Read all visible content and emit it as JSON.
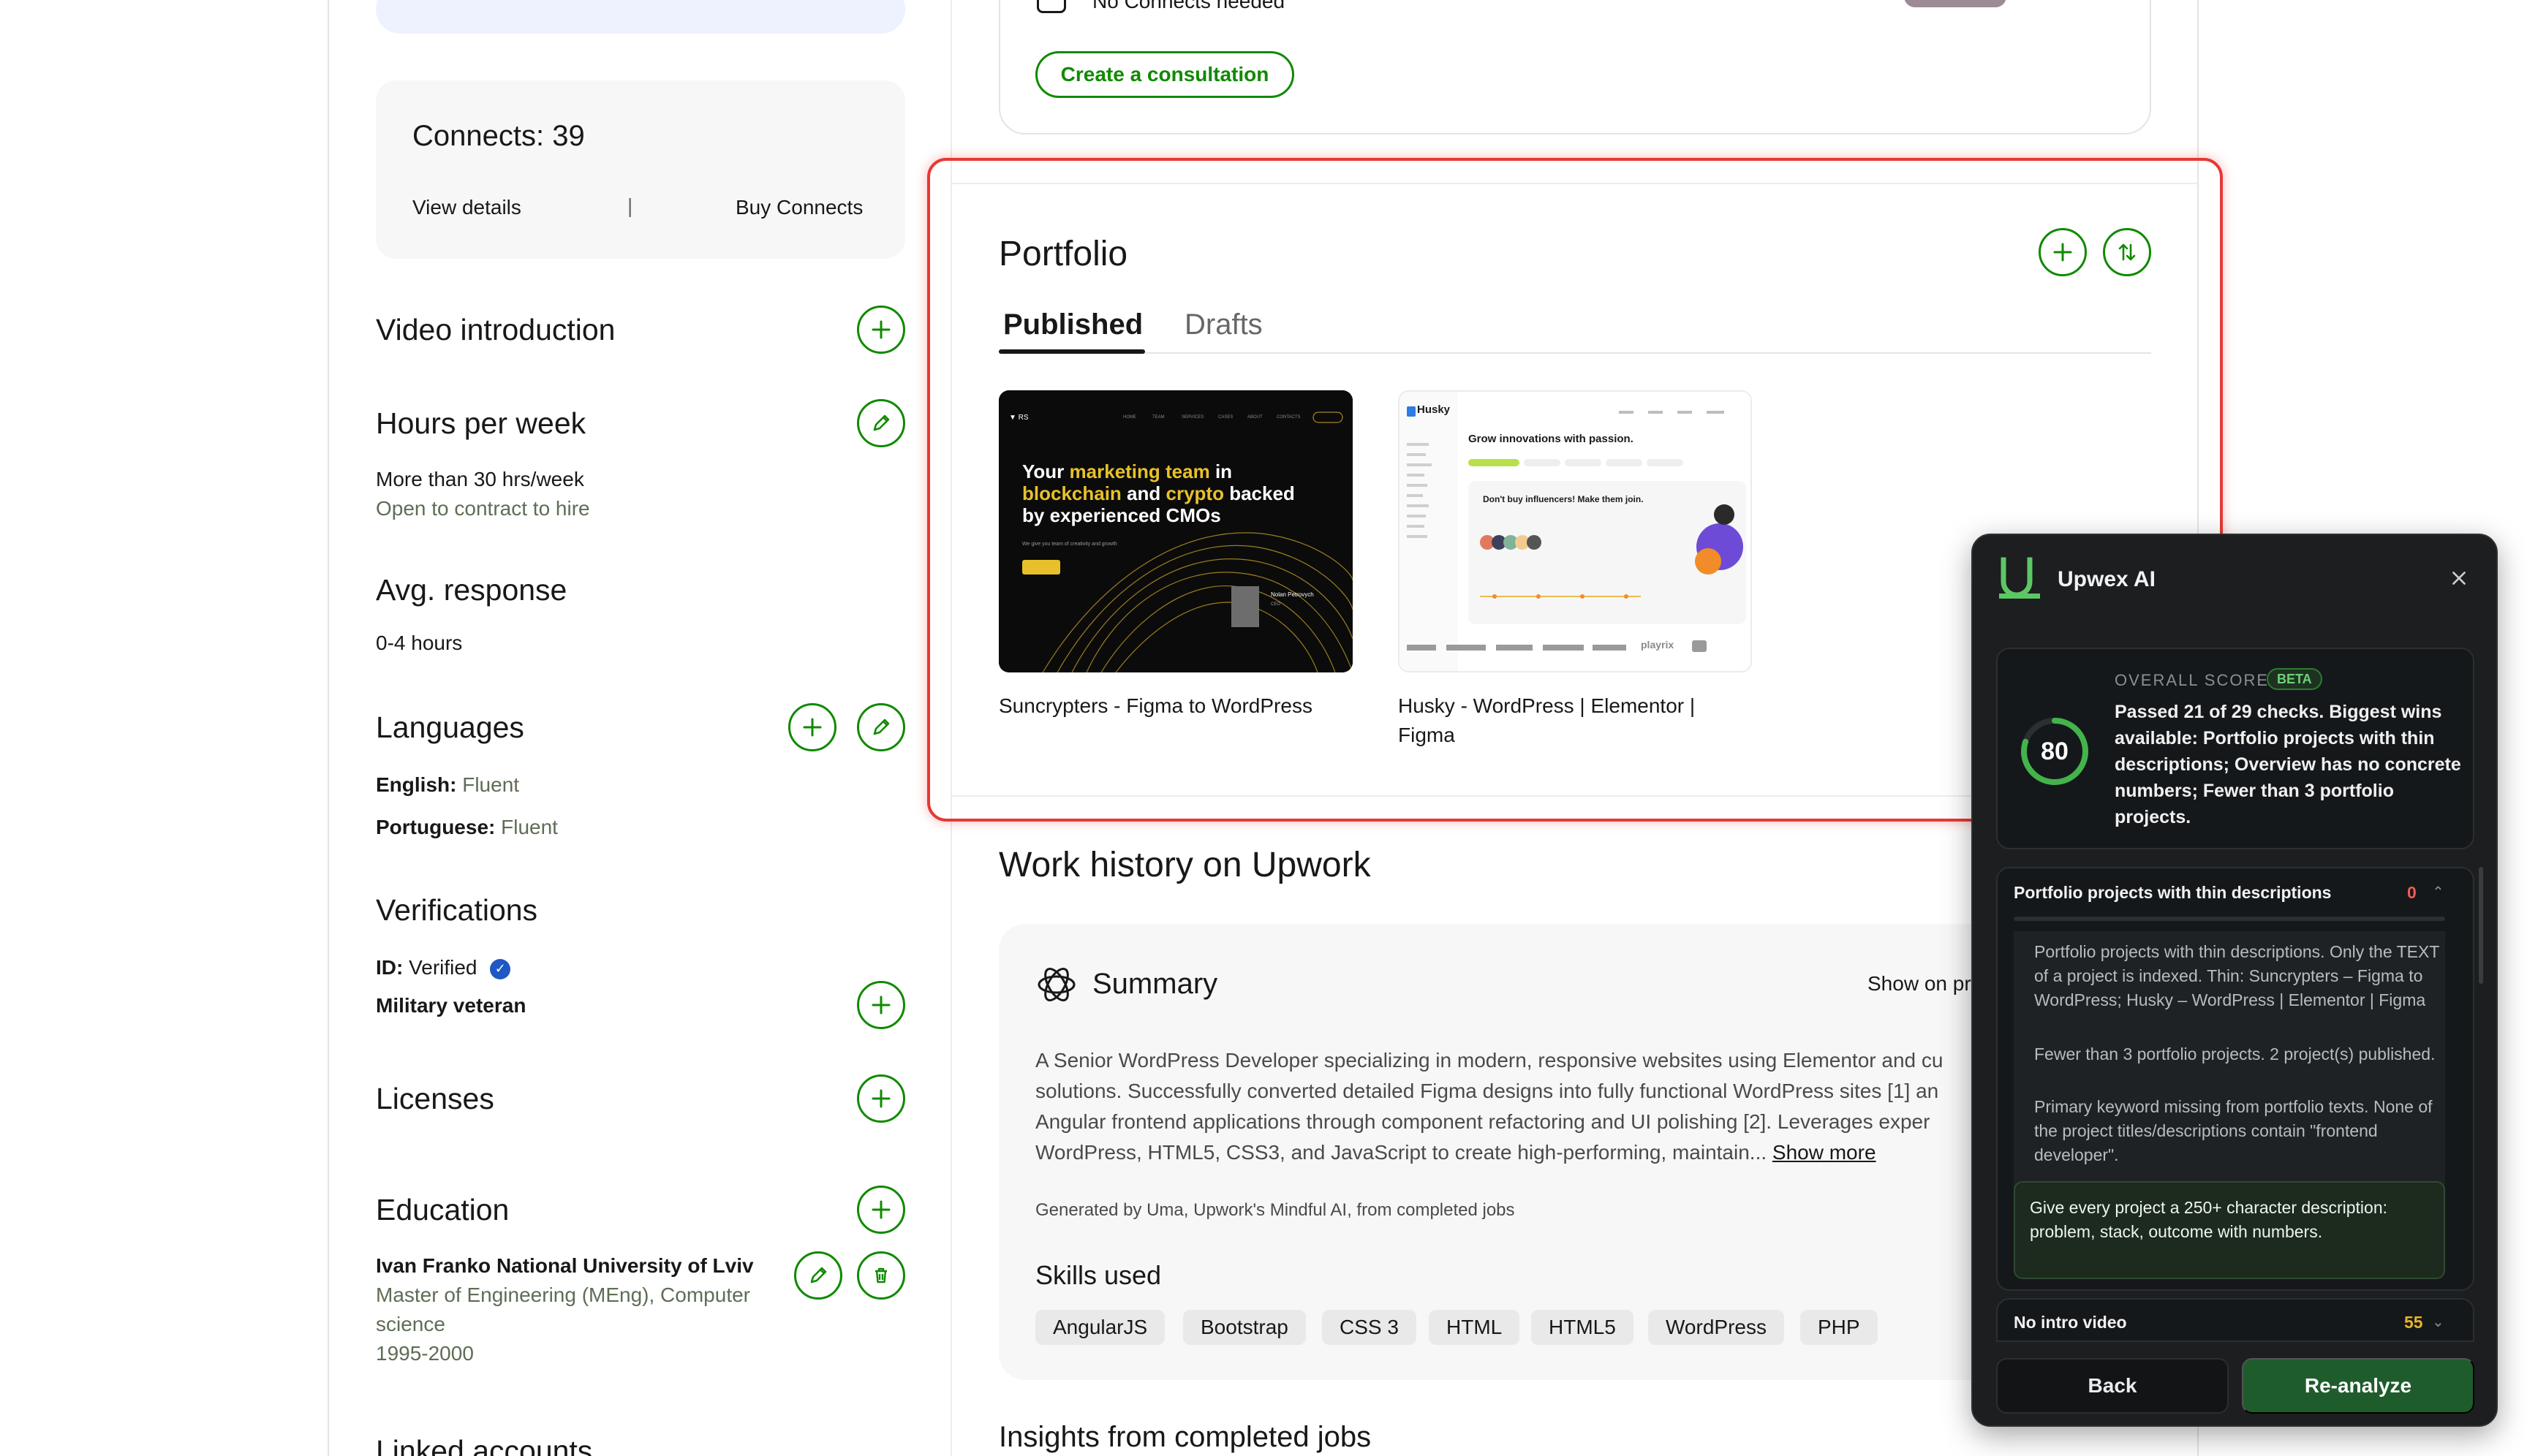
{
  "sidebar": {
    "connects": {
      "title": "Connects: 39",
      "view_details": "View details",
      "separator": "|",
      "buy_connects": "Buy Connects"
    },
    "video_intro": {
      "heading": "Video introduction"
    },
    "hours": {
      "heading": "Hours per week",
      "value": "More than 30 hrs/week",
      "sub": "Open to contract to hire"
    },
    "response": {
      "heading": "Avg. response",
      "value": "0-4 hours"
    },
    "languages": {
      "heading": "Languages",
      "items": [
        {
          "name": "English:",
          "level": "Fluent"
        },
        {
          "name": "Portuguese:",
          "level": "Fluent"
        }
      ]
    },
    "verifications": {
      "heading": "Verifications",
      "id_label": "ID:",
      "id_value": "Verified",
      "military": "Military veteran"
    },
    "licenses": {
      "heading": "Licenses"
    },
    "education": {
      "heading": "Education",
      "school": "Ivan Franko National University of Lviv",
      "degree_line1": "Master of Engineering (MEng), Computer",
      "degree_line2": "science",
      "years": "1995-2000"
    },
    "linked": {
      "heading": "Linked accounts"
    }
  },
  "consultation": {
    "no_connects": "No Connects needed",
    "button": "Create a consultation"
  },
  "portfolio": {
    "title": "Portfolio",
    "tabs": [
      "Published",
      "Drafts"
    ],
    "projects": [
      {
        "title": "Suncrypters - Figma to WordPress",
        "thumb_headline_1": "Your ",
        "thumb_headline_accent_1": "marketing team",
        "thumb_headline_2": " in",
        "thumb_headline_accent_2": "blockchain",
        "thumb_headline_3": " and ",
        "thumb_headline_accent_3": "crypto",
        "thumb_headline_4": " backed",
        "thumb_headline_5": "by experienced CMOs"
      },
      {
        "title_line1": "Husky - WordPress | Elementor |",
        "title_line2": "Figma",
        "thumb_brand": "Husky",
        "thumb_headline": "Grow innovations with passion.",
        "thumb_card_title": "Don't buy influencers! Make them join.",
        "thumb_footer_brand": "playrix"
      }
    ]
  },
  "work_history": {
    "title": "Work history on Upwork",
    "summary_title": "Summary",
    "show_on": "Show on pr",
    "summary_line1": "A Senior WordPress Developer specializing in modern, responsive websites using Elementor and cu",
    "summary_line2": "solutions. Successfully converted detailed Figma designs into fully functional WordPress sites [1] an",
    "summary_line3": "Angular frontend applications through component refactoring and UI polishing [2]. Leverages exper",
    "summary_line4": "WordPress, HTML5, CSS3, and JavaScript to create high-performing, maintain...",
    "show_more": "Show more",
    "generated": "Generated by Uma, Upwork's Mindful AI, from completed jobs",
    "skills_title": "Skills used",
    "skills": [
      "AngularJS",
      "Bootstrap",
      "CSS 3",
      "HTML",
      "HTML5",
      "WordPress",
      "PHP"
    ],
    "insights_title": "Insights from completed jobs"
  },
  "ai_panel": {
    "title": "Upwex AI",
    "overall_label": "OVERALL SCORE",
    "beta": "BETA",
    "score": "80",
    "score_fraction": 0.8,
    "score_desc": "Passed 21 of 29 checks. Biggest wins available: Portfolio projects with thin descriptions; Overview has no concrete numbers; Fewer than 3 portfolio projects.",
    "check_title": "Portfolio projects with thin descriptions",
    "check_score": "0",
    "check_p1": "Portfolio projects with thin descriptions. Only the TEXT of a project is indexed. Thin: Suncrypters – Figma to WordPress; Husky – WordPress | Elementor | Figma",
    "check_p2": "Fewer than 3 portfolio projects. 2 project(s) published.",
    "check_p3": "Primary keyword missing from portfolio texts. None of the project titles/descriptions contain \"frontend developer\".",
    "tip": "Give every project a 250+ character description: problem, stack, outcome with numbers.",
    "intro_title": "No intro video",
    "intro_score": "55",
    "back": "Back",
    "reanalyze": "Re-analyze"
  },
  "colors": {
    "upwork_green": "#108a00",
    "highlight_red": "#e53935",
    "ai_bg": "#1c1e1f",
    "ai_green": "#1e5c2c"
  }
}
